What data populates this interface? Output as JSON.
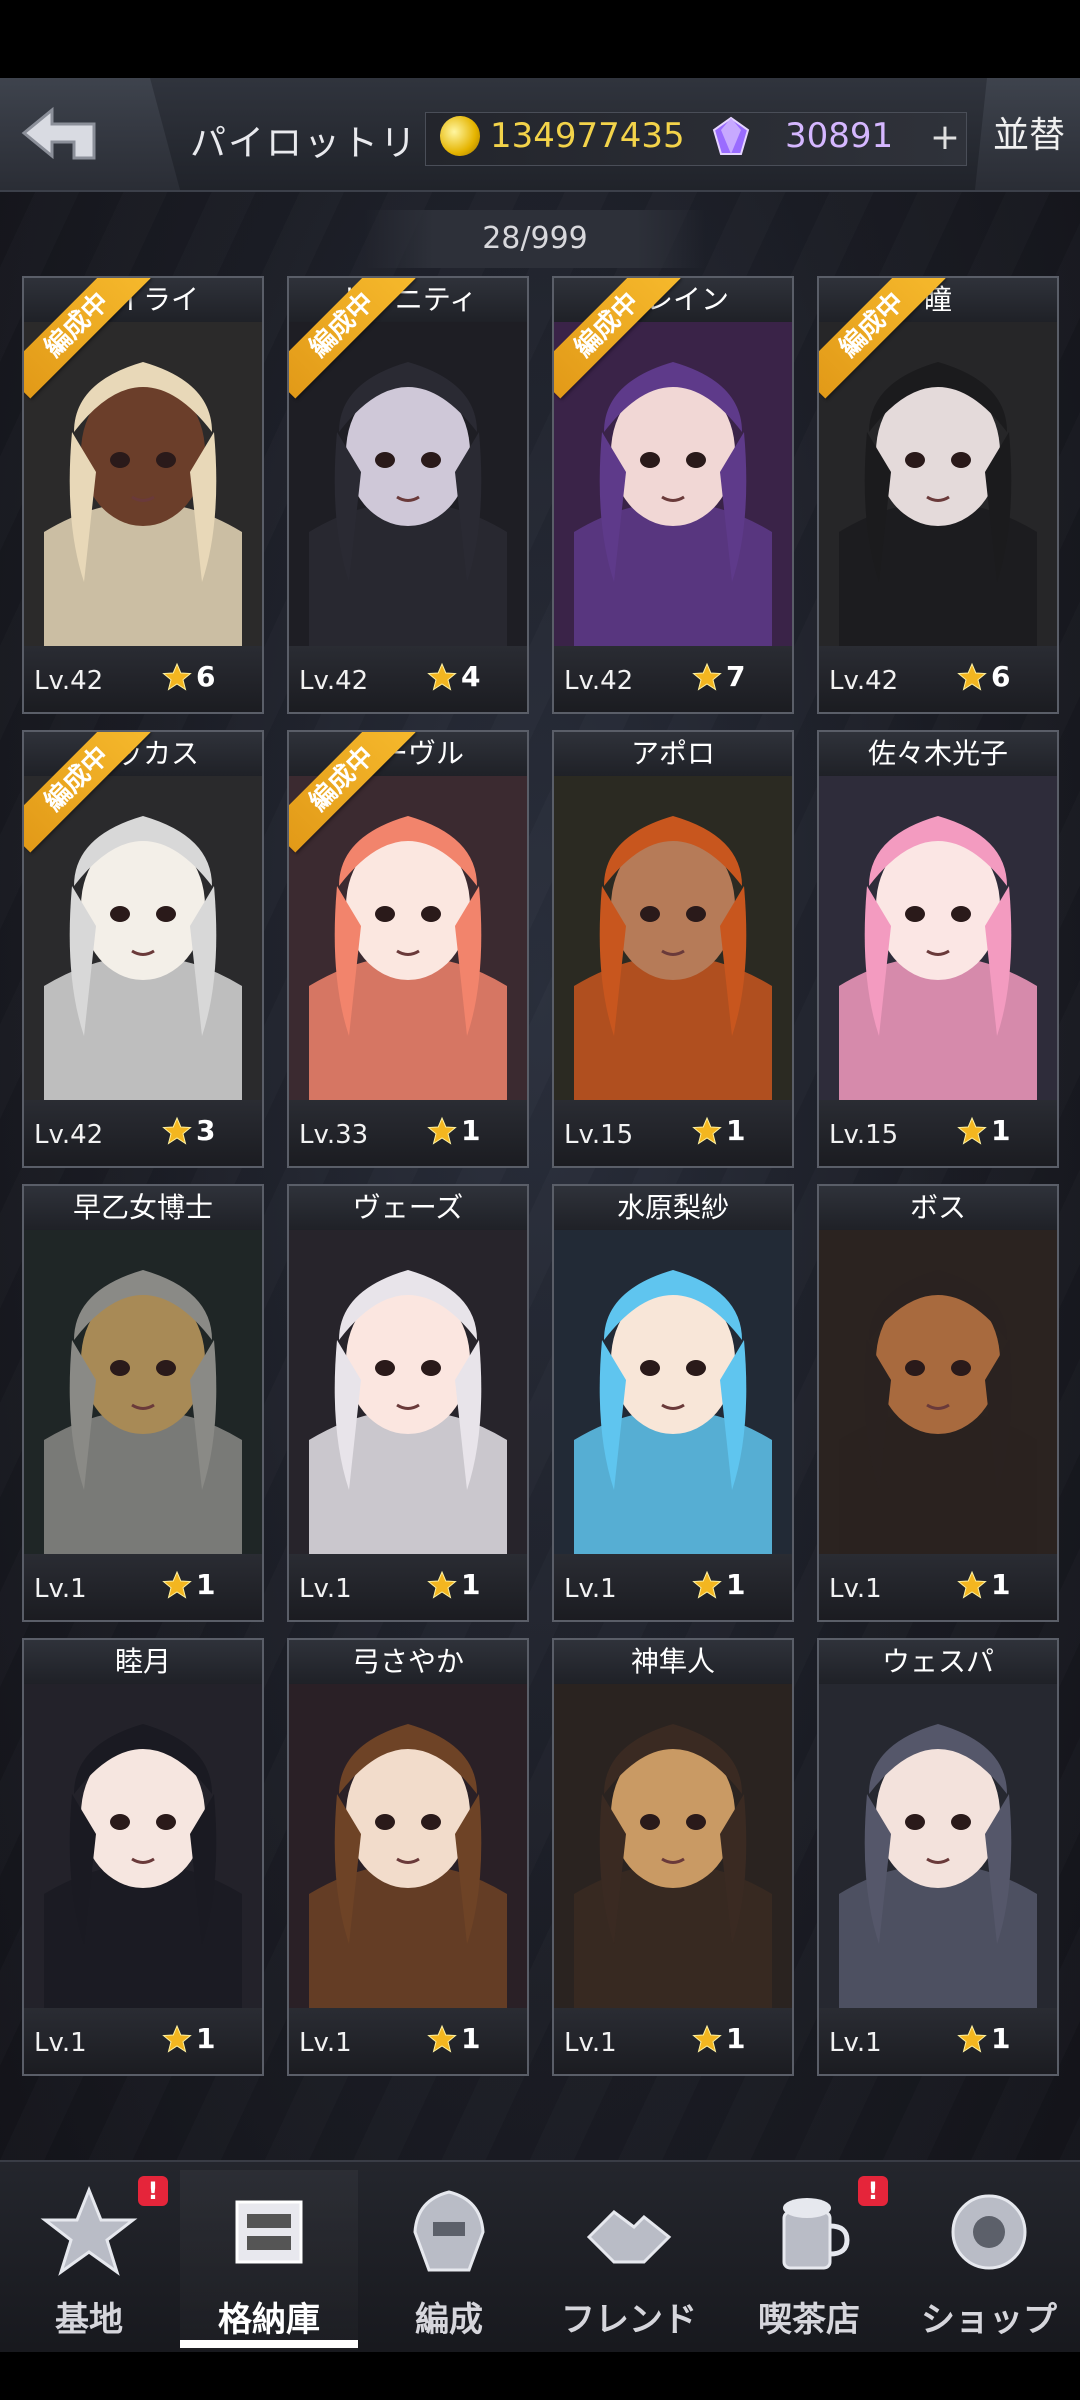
{
  "header": {
    "title": "パイロットリスト",
    "gold": "134977435",
    "gems": "30891",
    "plus_label": "+",
    "sort_label": "並替"
  },
  "count": "28/999",
  "ribbon_label": "編成中",
  "cards": [
    {
      "name": "ライライ",
      "level": "Lv.42",
      "stars": "6",
      "in_formation": true
    },
    {
      "name": "トリニティ",
      "level": "Lv.42",
      "stars": "4",
      "in_formation": true
    },
    {
      "name": "クレイン",
      "level": "Lv.42",
      "stars": "7",
      "in_formation": true
    },
    {
      "name": "瞳",
      "level": "Lv.42",
      "stars": "6",
      "in_formation": true
    },
    {
      "name": "バッカス",
      "level": "Lv.42",
      "stars": "3",
      "in_formation": true
    },
    {
      "name": "エーヴル",
      "level": "Lv.33",
      "stars": "1",
      "in_formation": true
    },
    {
      "name": "アポロ",
      "level": "Lv.15",
      "stars": "1",
      "in_formation": false
    },
    {
      "name": "佐々木光子",
      "level": "Lv.15",
      "stars": "1",
      "in_formation": false
    },
    {
      "name": "早乙女博士",
      "level": "Lv.1",
      "stars": "1",
      "in_formation": false
    },
    {
      "name": "ヴェーズ",
      "level": "Lv.1",
      "stars": "1",
      "in_formation": false
    },
    {
      "name": "水原梨紗",
      "level": "Lv.1",
      "stars": "1",
      "in_formation": false
    },
    {
      "name": "ボス",
      "level": "Lv.1",
      "stars": "1",
      "in_formation": false
    },
    {
      "name": "睦月",
      "level": "Lv.1",
      "stars": "1",
      "in_formation": false
    },
    {
      "name": "弓さやか",
      "level": "Lv.1",
      "stars": "1",
      "in_formation": false
    },
    {
      "name": "神隼人",
      "level": "Lv.1",
      "stars": "1",
      "in_formation": false
    },
    {
      "name": "ウェスパ",
      "level": "Lv.1",
      "stars": "1",
      "in_formation": false
    }
  ],
  "nav": [
    {
      "label": "基地",
      "icon": "base-icon",
      "alert": true
    },
    {
      "label": "格納庫",
      "icon": "hangar-icon",
      "alert": false,
      "active": true
    },
    {
      "label": "編成",
      "icon": "formation-icon",
      "alert": false
    },
    {
      "label": "フレンド",
      "icon": "friend-icon",
      "alert": false
    },
    {
      "label": "喫茶店",
      "icon": "cafe-icon",
      "alert": true
    },
    {
      "label": "ショップ",
      "icon": "shop-icon",
      "alert": false
    }
  ],
  "alert_mark": "!",
  "colors": {
    "ribbon": "#f2ad22",
    "gold_text": "#f3d34a",
    "gem_text": "#d5b7ff",
    "alert": "#e5253a"
  }
}
